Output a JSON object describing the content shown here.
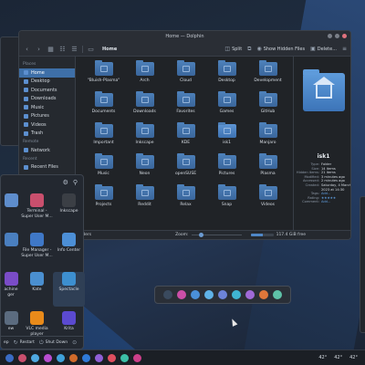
{
  "window": {
    "title": "Home — Dolphin",
    "controls": [
      "#7a7f88",
      "#7a7f88",
      "#e0727e"
    ]
  },
  "toolbar": {
    "back_icon": "chevron-left-icon",
    "forward_icon": "chevron-right-icon",
    "breadcrumb": "Home",
    "split_label": "Split",
    "hidden_label": "Show Hidden Files",
    "delete_label": "Delete..."
  },
  "sidebar": {
    "places_header": "Places",
    "items": [
      {
        "label": "Home",
        "active": true
      },
      {
        "label": "Desktop"
      },
      {
        "label": "Documents"
      },
      {
        "label": "Downloads"
      },
      {
        "label": "Music"
      },
      {
        "label": "Pictures"
      },
      {
        "label": "Videos"
      },
      {
        "label": "Trash"
      }
    ],
    "remote_header": "Remote",
    "remote_items": [
      {
        "label": "Network"
      }
    ],
    "recent_header": "Recent",
    "recent_items": [
      {
        "label": "Recent Files"
      }
    ]
  },
  "folders": [
    {
      "name": "\"Bluish-Plasma\""
    },
    {
      "name": "Arch"
    },
    {
      "name": "Cloud"
    },
    {
      "name": "Desktop"
    },
    {
      "name": "Development"
    },
    {
      "name": "Documents"
    },
    {
      "name": "Downloads"
    },
    {
      "name": "Favorites"
    },
    {
      "name": "Games"
    },
    {
      "name": "GitHub"
    },
    {
      "name": "Important"
    },
    {
      "name": "Inkscape"
    },
    {
      "name": "KDE"
    },
    {
      "name": "isk1",
      "selected": true
    },
    {
      "name": "Manjaro"
    },
    {
      "name": "Music"
    },
    {
      "name": "Neon"
    },
    {
      "name": "openSUSE"
    },
    {
      "name": "Pictures"
    },
    {
      "name": "Plasma"
    },
    {
      "name": "Projects"
    },
    {
      "name": "Reddit"
    },
    {
      "name": "Relax"
    },
    {
      "name": "Snap"
    },
    {
      "name": "Videos"
    }
  ],
  "info_panel": {
    "name": "isk1",
    "rows": [
      {
        "k": "Type:",
        "v": "Folder"
      },
      {
        "k": "Size:",
        "v": "14 items"
      },
      {
        "k": "Hidden items:",
        "v": "21 items"
      },
      {
        "k": "Modified:",
        "v": "3 minutes ago"
      },
      {
        "k": "Accessed:",
        "v": "2 minutes ago"
      },
      {
        "k": "Created:",
        "v": "Saturday, 4 March 2023 at 14:30"
      },
      {
        "k": "Tags:",
        "v": "Add...",
        "link": true
      },
      {
        "k": "Rating:",
        "v": "★★★★★",
        "link": true
      },
      {
        "k": "Comment:",
        "v": "Add...",
        "link": true
      }
    ]
  },
  "statusbar": {
    "left": "lders",
    "zoom_label": "Zoom:",
    "free_space": "117.4 GiB free",
    "used_fraction": 0.55
  },
  "launcher": {
    "apps": [
      {
        "label": "",
        "color": "#5e8dcc"
      },
      {
        "label": "Terminal -\nSuper User M...",
        "color": "#c94f6d"
      },
      {
        "label": "Inkscape",
        "color": "#3b3f45"
      },
      {
        "label": "",
        "color": "#4a7fbf"
      },
      {
        "label": "File Manager -\nSuper User M...",
        "color": "#3f78c7"
      },
      {
        "label": "Info Center",
        "color": "#4c8fd6"
      },
      {
        "label": "achine\nger",
        "color": "#7a4cc7"
      },
      {
        "label": "Kate",
        "color": "#4a8fd0"
      },
      {
        "label": "Spectacle",
        "color": "#3d8fcf",
        "selected": true
      },
      {
        "label": "ew",
        "color": "#5b6b7f"
      },
      {
        "label": "VLC media\nplayer",
        "color": "#e88a1a"
      },
      {
        "label": "Krita",
        "color": "#5b4ad0"
      }
    ],
    "bottom": {
      "sleep": "ep",
      "restart": "Restart",
      "shutdown": "Shut Down"
    }
  },
  "dock_colors": [
    "#3a4a5e",
    "#cc4fa8",
    "#4a8fd8",
    "#5fb3e8",
    "#6d84d8",
    "#3fb4d2",
    "#a06ad8",
    "#e0773a",
    "#5ec2a8"
  ],
  "taskbar": {
    "icons": [
      "#3a6cc4",
      "#c94f6d",
      "#4ea8e0",
      "#b84dd0",
      "#3fa1d9",
      "#d06a2a",
      "#2f7ad8",
      "#8f5fd6",
      "#e04f5f",
      "#3cbfa7",
      "#cc3f8a"
    ],
    "tray": [
      "42°",
      "42°",
      "42°"
    ]
  }
}
